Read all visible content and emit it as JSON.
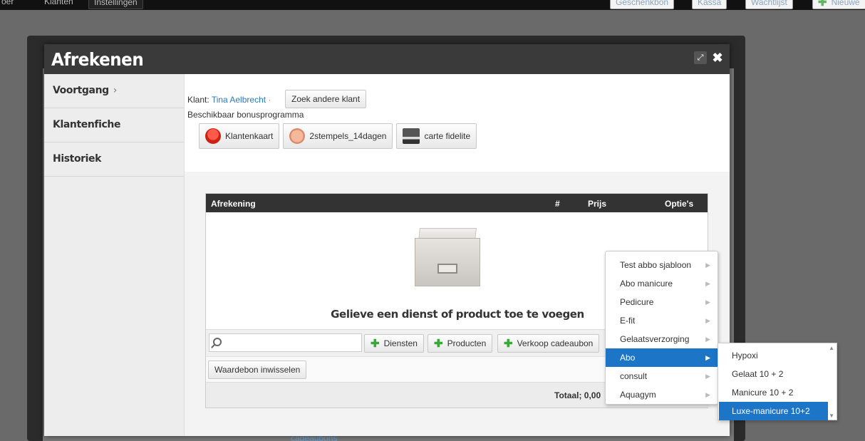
{
  "background": {
    "nav_left": [
      "oer",
      "Klanten",
      "Instellingen"
    ],
    "nav_right": [
      "Geschenkbon",
      "Kassa",
      "Wachtlijst",
      "Nieuwe"
    ],
    "bottom_link": "cadeaubons"
  },
  "modal": {
    "title": "Afrekenen",
    "sidebar": [
      {
        "label": "Voortgang",
        "chevron": "›"
      },
      {
        "label": "Klantenfiche"
      },
      {
        "label": "Historiek"
      }
    ],
    "client": {
      "prefix": "Klant:",
      "name": "Tina Aelbrecht",
      "separator": "·",
      "search_button": "Zoek andere klant",
      "bonus_label": "Beschikbaar bonusprogramma",
      "bonus_programs": [
        "Klantenkaart",
        "2stempels_14dagen",
        "carte fidelite"
      ]
    },
    "checkout": {
      "headers": {
        "name": "Afrekening",
        "count": "#",
        "price": "Prijs",
        "options": "Optie's"
      },
      "empty_message": "Gelieve een dienst of product toe te voegen",
      "search_placeholder": "",
      "buttons": {
        "services": "Diensten",
        "products": "Producten",
        "giftcard": "Verkoop cadeaubon"
      },
      "voucher_button": "Waardebon inwisselen",
      "total_label": "Totaal;",
      "total_value": "0,00"
    }
  },
  "menu_categories": [
    "Test abbo sjabloon",
    "Abo manicure",
    "Pedicure",
    "E-fit",
    "Gelaatsverzorging",
    "Abo",
    "consult",
    "Aquagym"
  ],
  "menu_active_category": "Abo",
  "submenu_items": [
    "Hypoxi",
    "Gelaat 10 + 2",
    "Manicure 10 + 2",
    "Luxe-manicure 10+2"
  ],
  "submenu_active": "Luxe-manicure 10+2",
  "colors": {
    "accent": "#1d75c7",
    "header": "#3a3a3a",
    "link": "#2a7ac0",
    "plus": "#3aa73a"
  }
}
